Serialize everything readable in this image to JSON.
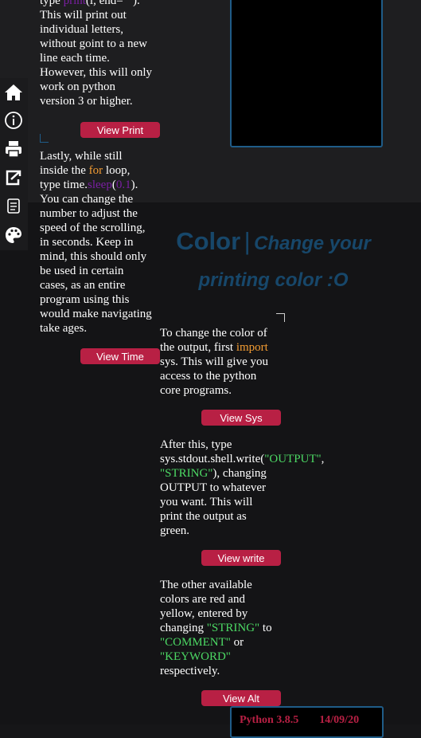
{
  "sidebar": {
    "items": [
      {
        "icon": "home-icon"
      },
      {
        "icon": "info-icon"
      },
      {
        "icon": "printer-icon"
      },
      {
        "icon": "export-icon"
      },
      {
        "icon": "scroll-icon"
      },
      {
        "icon": "palette-icon"
      }
    ]
  },
  "colors": {
    "accent": "#b82044",
    "heading": "#17476a",
    "console_border": "#1f5c88",
    "keyword_orange": "#f39c33",
    "keyword_purple": "#7a1fa2",
    "string_green": "#4cd964"
  },
  "left": {
    "p1": {
      "l1_a": "type ",
      "l1_kw": "print",
      "l1_b": "(i, end=\"\").",
      "l2": "This will print out",
      "l3": "individual letters,",
      "l4": "without goint to a new",
      "l5": "line each time.",
      "l6": "However, this will only",
      "l7": "work on python",
      "l8": "version 3 or higher."
    },
    "btn_print": "View Print",
    "p2": {
      "l1": "Lastly, while still",
      "l2_a": "inside the ",
      "l2_kw": "for",
      "l2_b": " loop,",
      "l3_a": "type time.",
      "l3_kw": "sleep",
      "l3_b": "(",
      "l3_num": "0.1",
      "l3_c": ").",
      "l4": "You can change the",
      "l5": "number to adjust the",
      "l6": "speed of the scrolling,",
      "l7": "in seconds. Keep in",
      "l8": "mind, this should only",
      "l9": "be used in certain",
      "l10": "cases, as an entire",
      "l11": "program using this",
      "l12": "would make navigating",
      "l13": "take ages."
    },
    "btn_time": "View Time"
  },
  "heading": {
    "title": "Color",
    "sep": "|",
    "sub1": "Change your",
    "sub2": "printing color :O"
  },
  "right": {
    "p1": {
      "l1": "To change the color of",
      "l2_a": "the output, first ",
      "l2_kw": "import",
      "l3": "sys. This will give you",
      "l4": "access to the python",
      "l5": "core programs."
    },
    "btn_sys": "View Sys",
    "p2": {
      "l1": "After this, type",
      "l2_a": "sys.stdout.shell.write(",
      "l2_s": "\"OUTPUT\"",
      "l2_b": ",",
      "l3_s": "\"STRING\"",
      "l3_b": "), changing",
      "l4": "OUTPUT to whatever",
      "l5": "you want. This will",
      "l6": "print the output as",
      "l7": "green."
    },
    "btn_write": "View write",
    "p3": {
      "l1": "The other available",
      "l2": "colors are red and",
      "l3": "yellow, entered by",
      "l4_a": "changing ",
      "l4_s": "\"STRING\"",
      "l4_b": " to",
      "l5_s": "\"COMMENT\"",
      "l5_b": " or",
      "l6_s": "\"KEYWORD\"",
      "l7": "respectively."
    },
    "btn_alt": "View Alt"
  },
  "console_bottom": {
    "version": "Python 3.8.5",
    "date": "14/09/20"
  }
}
